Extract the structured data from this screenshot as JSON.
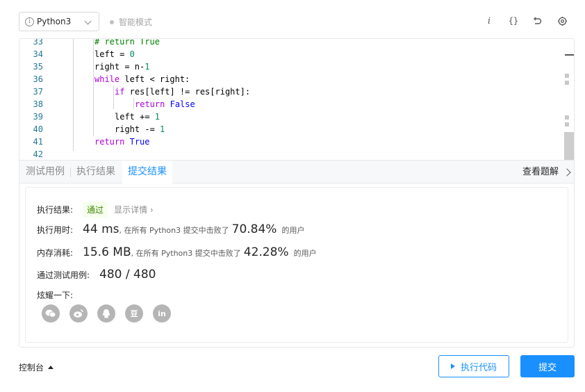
{
  "toolbar": {
    "language": "Python3",
    "smart_mode": "智能模式",
    "icons": [
      "info-icon",
      "braces-icon",
      "undo-icon",
      "settings-icon"
    ]
  },
  "editor": {
    "lines": [
      {
        "n": "33",
        "indent": 2,
        "html": [
          {
            "c": "cmt",
            "t": "# return True"
          }
        ]
      },
      {
        "n": "34",
        "indent": 2,
        "html": [
          {
            "c": "",
            "t": "left = "
          },
          {
            "c": "num",
            "t": "0"
          }
        ]
      },
      {
        "n": "35",
        "indent": 2,
        "html": [
          {
            "c": "",
            "t": "right = n-"
          },
          {
            "c": "num",
            "t": "1"
          }
        ]
      },
      {
        "n": "36",
        "indent": 2,
        "html": [
          {
            "c": "kw2",
            "t": "while"
          },
          {
            "c": "",
            "t": " left < right:"
          }
        ]
      },
      {
        "n": "37",
        "indent": 3,
        "html": [
          {
            "c": "kw2",
            "t": "if"
          },
          {
            "c": "",
            "t": " res[left] != res[right]:"
          }
        ]
      },
      {
        "n": "38",
        "indent": 4,
        "html": [
          {
            "c": "kw2",
            "t": "return"
          },
          {
            "c": "",
            "t": " "
          },
          {
            "c": "kw",
            "t": "False"
          }
        ]
      },
      {
        "n": "39",
        "indent": 3,
        "html": [
          {
            "c": "",
            "t": "left += "
          },
          {
            "c": "num",
            "t": "1"
          }
        ]
      },
      {
        "n": "40",
        "indent": 3,
        "html": [
          {
            "c": "",
            "t": "right -= "
          },
          {
            "c": "num",
            "t": "1"
          }
        ]
      },
      {
        "n": "41",
        "indent": 2,
        "html": [
          {
            "c": "kw2",
            "t": "return"
          },
          {
            "c": "",
            "t": " "
          },
          {
            "c": "kw",
            "t": "True"
          }
        ]
      },
      {
        "n": "42",
        "indent": 0,
        "html": []
      }
    ]
  },
  "tabs": {
    "items": [
      "测试用例",
      "执行结果",
      "提交结果"
    ],
    "active": "提交结果",
    "view_solution": "查看题解"
  },
  "result": {
    "status_label": "执行结果:",
    "status_value": "通过",
    "show_details": "显示详情 ›",
    "time_label": "执行用时:",
    "time_value": "44 ms",
    "time_text": ", 在所有 Python3 提交中击败了",
    "time_pct": "70.84%",
    "time_suffix": "的用户",
    "mem_label": "内存消耗:",
    "mem_value": "15.6 MB",
    "mem_text": ", 在所有 Python3 提交中击败了",
    "mem_pct": "42.28%",
    "mem_suffix": "的用户",
    "cases_label": "通过测试用例:",
    "cases_value": "480 / 480",
    "share_label": "炫耀一下:",
    "share_icons": [
      {
        "name": "wechat-icon",
        "glyph": ""
      },
      {
        "name": "weibo-icon",
        "glyph": ""
      },
      {
        "name": "qq-icon",
        "glyph": ""
      },
      {
        "name": "douban-icon",
        "glyph": "豆"
      },
      {
        "name": "linkedin-icon",
        "glyph": "in"
      }
    ]
  },
  "bottom": {
    "console": "控制台",
    "run": "执行代码",
    "submit": "提交"
  }
}
